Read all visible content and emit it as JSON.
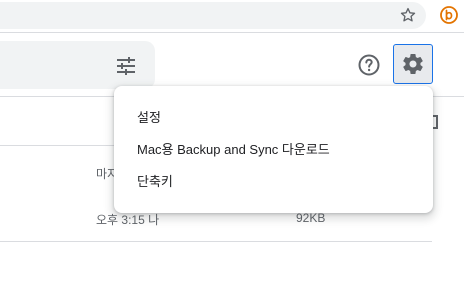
{
  "menu": {
    "items": [
      {
        "label": "설정"
      },
      {
        "label": "Mac용 Backup and Sync 다운로드"
      },
      {
        "label": "단축키"
      }
    ]
  },
  "list": {
    "header_partial": "마지",
    "rows": [
      {
        "modified": "오후 3:15 나",
        "size": "92KB"
      }
    ]
  },
  "icons": {
    "star": "star-outline-icon",
    "extension": "extension-icon",
    "filter": "search-options-icon",
    "help": "help-icon",
    "settings": "gear-icon",
    "view": "view-toggle-icon"
  },
  "colors": {
    "accent": "#1a73e8",
    "extension": "#e37400",
    "divider": "#dadce0",
    "surface": "#f1f3f4"
  }
}
